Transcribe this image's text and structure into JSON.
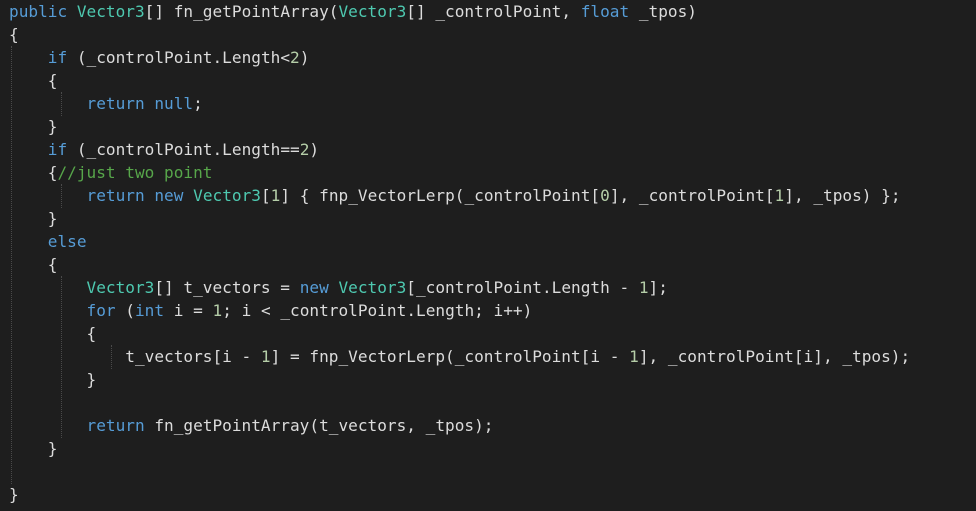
{
  "editor": {
    "colors": {
      "background": "#1e1e1e",
      "keyword": "#569cd6",
      "type": "#4ec9b0",
      "comment": "#57a64a",
      "number": "#b5cea8",
      "plain": "#dcdcdc"
    },
    "lines": [
      {
        "tokens": [
          [
            "keyword",
            "public"
          ],
          [
            "plain",
            " "
          ],
          [
            "type",
            "Vector3"
          ],
          [
            "plain",
            "[] fn_getPointArray("
          ],
          [
            "type",
            "Vector3"
          ],
          [
            "plain",
            "[] _controlPoint, "
          ],
          [
            "keyword",
            "float"
          ],
          [
            "plain",
            " _tpos)"
          ]
        ]
      },
      {
        "tokens": [
          [
            "plain",
            "{"
          ]
        ]
      },
      {
        "tokens": [
          [
            "plain",
            "    "
          ],
          [
            "keyword",
            "if"
          ],
          [
            "plain",
            " (_controlPoint.Length<"
          ],
          [
            "number",
            "2"
          ],
          [
            "plain",
            ")"
          ]
        ]
      },
      {
        "tokens": [
          [
            "plain",
            "    {"
          ]
        ]
      },
      {
        "tokens": [
          [
            "plain",
            "        "
          ],
          [
            "keyword",
            "return"
          ],
          [
            "plain",
            " "
          ],
          [
            "keyword",
            "null"
          ],
          [
            "plain",
            ";"
          ]
        ]
      },
      {
        "tokens": [
          [
            "plain",
            "    }"
          ]
        ]
      },
      {
        "tokens": [
          [
            "plain",
            "    "
          ],
          [
            "keyword",
            "if"
          ],
          [
            "plain",
            " (_controlPoint.Length=="
          ],
          [
            "number",
            "2"
          ],
          [
            "plain",
            ")"
          ]
        ]
      },
      {
        "tokens": [
          [
            "plain",
            "    {"
          ],
          [
            "comment",
            "//just two point"
          ]
        ]
      },
      {
        "tokens": [
          [
            "plain",
            "        "
          ],
          [
            "keyword",
            "return"
          ],
          [
            "plain",
            " "
          ],
          [
            "keyword",
            "new"
          ],
          [
            "plain",
            " "
          ],
          [
            "type",
            "Vector3"
          ],
          [
            "plain",
            "["
          ],
          [
            "number",
            "1"
          ],
          [
            "plain",
            "] { fnp_VectorLerp(_controlPoint["
          ],
          [
            "number",
            "0"
          ],
          [
            "plain",
            "], _controlPoint["
          ],
          [
            "number",
            "1"
          ],
          [
            "plain",
            "], _tpos) };"
          ]
        ]
      },
      {
        "tokens": [
          [
            "plain",
            "    }"
          ]
        ]
      },
      {
        "tokens": [
          [
            "plain",
            "    "
          ],
          [
            "keyword",
            "else"
          ]
        ]
      },
      {
        "tokens": [
          [
            "plain",
            "    {"
          ]
        ]
      },
      {
        "tokens": [
          [
            "plain",
            "        "
          ],
          [
            "type",
            "Vector3"
          ],
          [
            "plain",
            "[] t_vectors = "
          ],
          [
            "keyword",
            "new"
          ],
          [
            "plain",
            " "
          ],
          [
            "type",
            "Vector3"
          ],
          [
            "plain",
            "[_controlPoint.Length - "
          ],
          [
            "number",
            "1"
          ],
          [
            "plain",
            "];"
          ]
        ]
      },
      {
        "tokens": [
          [
            "plain",
            "        "
          ],
          [
            "keyword",
            "for"
          ],
          [
            "plain",
            " ("
          ],
          [
            "keyword",
            "int"
          ],
          [
            "plain",
            " i = "
          ],
          [
            "number",
            "1"
          ],
          [
            "plain",
            "; i < _controlPoint.Length; i++)"
          ]
        ]
      },
      {
        "tokens": [
          [
            "plain",
            "        {"
          ]
        ]
      },
      {
        "tokens": [
          [
            "plain",
            "            t_vectors[i - "
          ],
          [
            "number",
            "1"
          ],
          [
            "plain",
            "] = fnp_VectorLerp(_controlPoint[i - "
          ],
          [
            "number",
            "1"
          ],
          [
            "plain",
            "], _controlPoint[i], _tpos);"
          ]
        ]
      },
      {
        "tokens": [
          [
            "plain",
            "        }"
          ]
        ]
      },
      {
        "tokens": [
          [
            "plain",
            ""
          ]
        ]
      },
      {
        "tokens": [
          [
            "plain",
            "        "
          ],
          [
            "keyword",
            "return"
          ],
          [
            "plain",
            " fn_getPointArray(t_vectors, _tpos);"
          ]
        ]
      },
      {
        "tokens": [
          [
            "plain",
            "    }"
          ]
        ]
      },
      {
        "tokens": [
          [
            "plain",
            ""
          ]
        ]
      },
      {
        "tokens": [
          [
            "plain",
            "}"
          ]
        ]
      }
    ]
  }
}
